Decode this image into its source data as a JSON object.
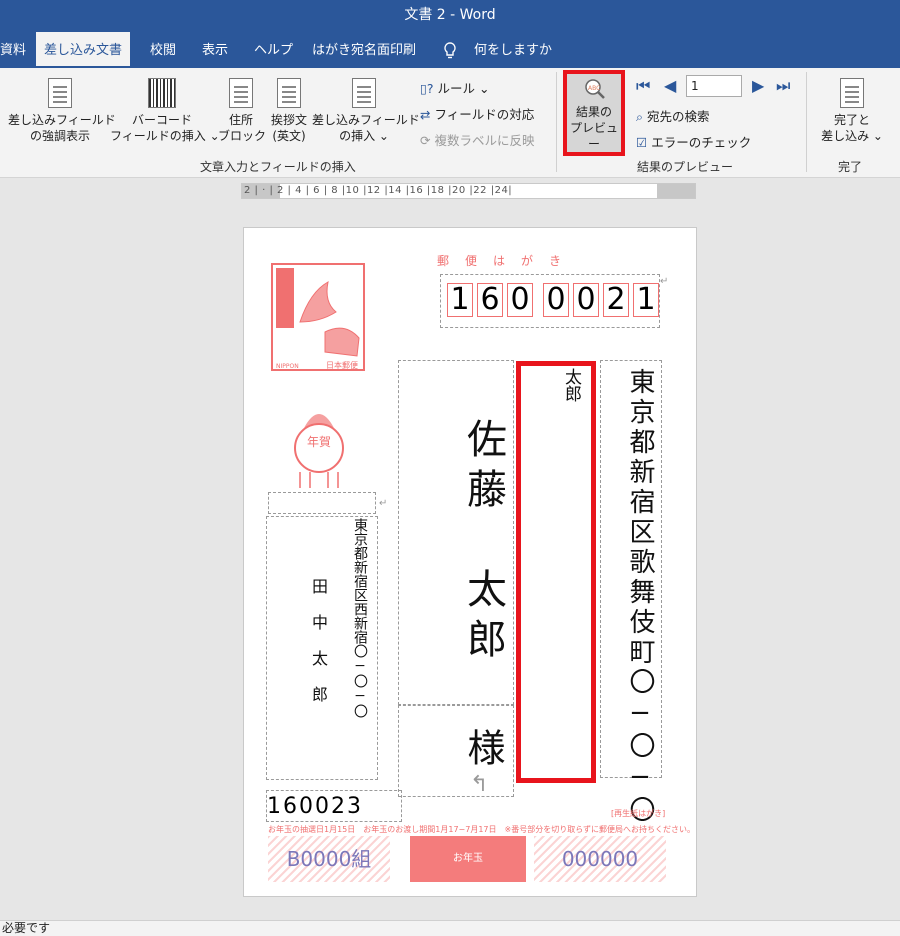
{
  "window": {
    "title": "文書 2  -  Word"
  },
  "tabs": [
    {
      "label": "資料"
    },
    {
      "label": "差し込み文書",
      "active": true
    },
    {
      "label": "校閲"
    },
    {
      "label": "表示"
    },
    {
      "label": "ヘルプ"
    },
    {
      "label": "はがき宛名面印刷"
    },
    {
      "label": "何をしますか"
    }
  ],
  "ribbon": {
    "highlight_fields": {
      "line1": "差し込みフィールド",
      "line2": "の強調表示"
    },
    "barcode_insert": {
      "line1": "バーコード",
      "line2": "フィールドの挿入 ⌄"
    },
    "address_block": {
      "line1": "住所",
      "line2": "ブロック"
    },
    "greeting": {
      "line1": "挨拶文",
      "line2": "(英文)"
    },
    "insert_merge_field": {
      "line1": "差し込みフィールド",
      "line2": "の挿入 ⌄"
    },
    "rules": "ルール ⌄",
    "match_fields": "フィールドの対応",
    "update_labels": "複数ラベルに反映",
    "group_write_insert": "文章入力とフィールドの挿入",
    "preview_results": {
      "line1": "結果の",
      "line2": "プレビュー"
    },
    "record_number": "1",
    "find_recipient": "宛先の検索",
    "check_errors": "エラーのチェック",
    "group_preview": "結果のプレビュー",
    "finish_merge": {
      "line1": "完了と",
      "line2": "差し込み ⌄"
    },
    "group_finish": "完了"
  },
  "ruler": {
    "ticks": "2 |  ·  |  2  |  4  |  6  |  8  |10 |12 |14 |16 |18 |20 |22 |24|"
  },
  "postcard": {
    "header": "郵便はがき",
    "zip": [
      "1",
      "6",
      "0",
      "0",
      "0",
      "2",
      "1"
    ],
    "recipient_address": "東京都新宿区歌舞伎町〇−〇−〇",
    "recipient_building": "太郎",
    "recipient_name": "佐藤　太郎",
    "honorific": "様",
    "sender_address": "東京都新宿区西新宿〇−〇−〇",
    "sender_name": "田中太郎",
    "sender_zip": "160023",
    "nippon_label": "NIPPON",
    "japan_post": "日本郵便",
    "nenga_label": "年賀",
    "note": "お年玉の抽選日1月15日　お年玉のお渡し期間1月17−7月17日　※番号部分を切り取らずに郵便局へお持ちください。",
    "recycled": "[再生紙はがき]",
    "lot_group": "B0000組",
    "lot_number": "000000",
    "lottery_label": "お年玉"
  },
  "statusbar": {
    "text": "必要です"
  },
  "colors": {
    "accent": "#2b579a",
    "highlight": "#e8141c",
    "stamp": "#f07070"
  }
}
